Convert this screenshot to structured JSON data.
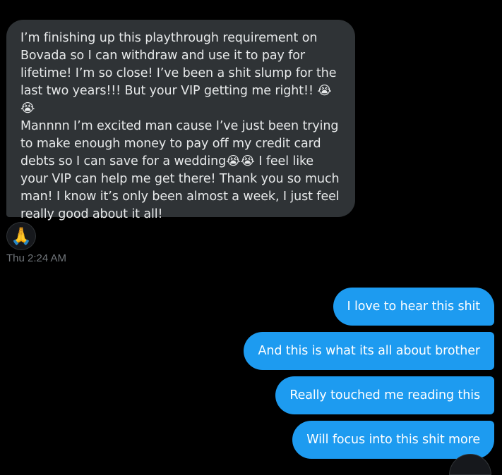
{
  "conversation": {
    "incoming": {
      "text": "I’m finishing up this playthrough requirement on\nBovada so I can withdraw and use it to pay for\nlifetime! I’m so close! I’ve been a shit slump for the\nlast two years!!! But your VIP getting me right!! 😭😭\nMannnn I’m excited man cause I’ve just been trying\nto make enough money to pay off my credit card\ndebts so I can save for a wedding😭😭 I feel like\nyour VIP can help me get there! Thank you so much\nman! I know it’s only been almost a week, I just feel\nreally good about it all!",
      "reaction": "🙏",
      "timestamp": "Thu 2:24 AM"
    },
    "outgoing": [
      {
        "text": "I love to hear this shit"
      },
      {
        "text": "And this is what its all about brother"
      },
      {
        "text": "Really touched me reading this"
      },
      {
        "text": "Will focus into this shit more"
      }
    ]
  },
  "colors": {
    "background": "#000000",
    "incoming_bubble": "#2f3336",
    "outgoing_bubble": "#1d9bf0",
    "timestamp": "#71767b"
  }
}
